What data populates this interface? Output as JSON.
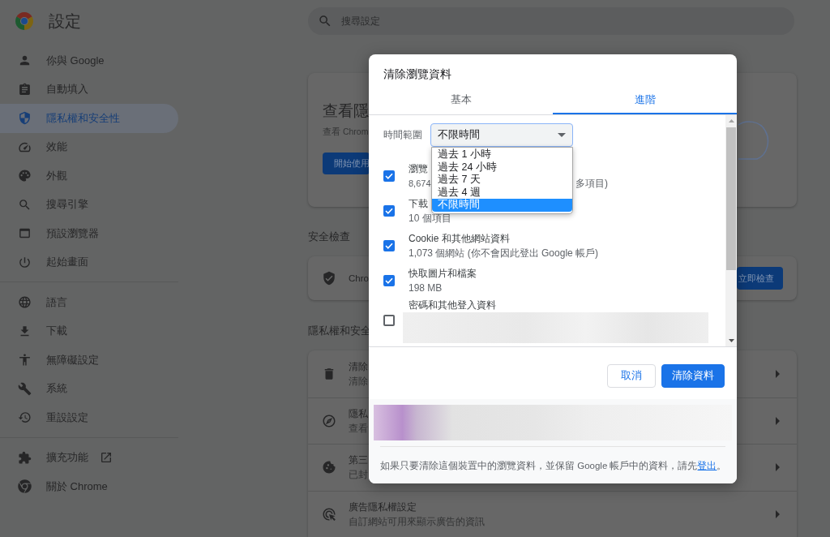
{
  "header": {
    "title": "設定",
    "search": {
      "placeholder": "搜尋設定"
    }
  },
  "sidebar": {
    "sections": [
      {
        "items": [
          {
            "label": "你與 Google",
            "selected": false,
            "external": false
          },
          {
            "label": "自動填入",
            "selected": false,
            "external": false
          },
          {
            "label": "隱私權和安全性",
            "selected": true,
            "external": false
          },
          {
            "label": "效能",
            "selected": false,
            "external": false
          },
          {
            "label": "外觀",
            "selected": false,
            "external": false
          },
          {
            "label": "搜尋引擎",
            "selected": false,
            "external": false
          },
          {
            "label": "預設瀏覽器",
            "selected": false,
            "external": false
          },
          {
            "label": "起始畫面",
            "selected": false,
            "external": false
          }
        ]
      },
      {
        "items": [
          {
            "label": "語言",
            "selected": false,
            "external": false
          },
          {
            "label": "下載",
            "selected": false,
            "external": false
          },
          {
            "label": "無障礙設定",
            "selected": false,
            "external": false
          },
          {
            "label": "系統",
            "selected": false,
            "external": false
          },
          {
            "label": "重設設定",
            "selected": false,
            "external": false
          }
        ]
      },
      {
        "items": [
          {
            "label": "擴充功能",
            "selected": false,
            "external": true
          },
          {
            "label": "關於 Chrome",
            "selected": false,
            "external": false
          }
        ]
      }
    ]
  },
  "main": {
    "intro_card": {
      "heading": "查看隱",
      "text": "查看 Chrom",
      "button": "開始使用"
    },
    "safety_check": {
      "heading": "安全檢查",
      "text": "Chro",
      "button": "立即檢查"
    },
    "privacy": {
      "heading": "隱私權和安全",
      "rows": [
        {
          "title": "清除",
          "subtitle": "清除"
        },
        {
          "title": "隱私",
          "subtitle": "查看"
        },
        {
          "title": "第三",
          "subtitle": "已封"
        },
        {
          "title": "廣告隱私權設定",
          "subtitle": "自訂網站可用來顯示廣告的資訊"
        }
      ]
    }
  },
  "dialog": {
    "title": "清除瀏覽資料",
    "tabs": [
      {
        "label": "基本",
        "selected": false
      },
      {
        "label": "進階",
        "selected": true
      }
    ],
    "time_range": {
      "label": "時間範圍",
      "value": "不限時間",
      "expanded": true,
      "options": [
        {
          "label": "過去 1 小時",
          "selected": false
        },
        {
          "label": "過去 24 小時",
          "selected": false
        },
        {
          "label": "過去 7 天",
          "selected": false
        },
        {
          "label": "過去 4 週",
          "selected": false
        },
        {
          "label": "不限時間",
          "selected": true
        }
      ]
    },
    "items": [
      {
        "kind": "text",
        "title": "瀏覽",
        "subtitle_parts": [
          "8,674",
          "多項目)"
        ],
        "checked": true
      },
      {
        "kind": "text",
        "title": "下載",
        "subtitle_parts": [
          "10 個項目"
        ],
        "checked": true
      },
      {
        "kind": "text",
        "title": "Cookie 和其他網站資料",
        "subtitle_parts": [
          "1,073 個網站 (你不會因此登出 Google 帳戶)"
        ],
        "checked": true
      },
      {
        "kind": "text",
        "title": "快取圖片和檔案",
        "subtitle_parts": [
          "198 MB"
        ],
        "checked": true
      },
      {
        "kind": "blurred",
        "title": "密碼和其他登入資料",
        "checked": false
      }
    ],
    "buttons": [
      {
        "label": "取消",
        "kind": "secondary"
      },
      {
        "label": "清除資料",
        "kind": "primary"
      }
    ],
    "footer_note": {
      "before": "如果只要清除這個裝置中的瀏覽資料，並保留 Google 帳戶中的資料，請先",
      "link": "登出",
      "after": "。"
    }
  }
}
